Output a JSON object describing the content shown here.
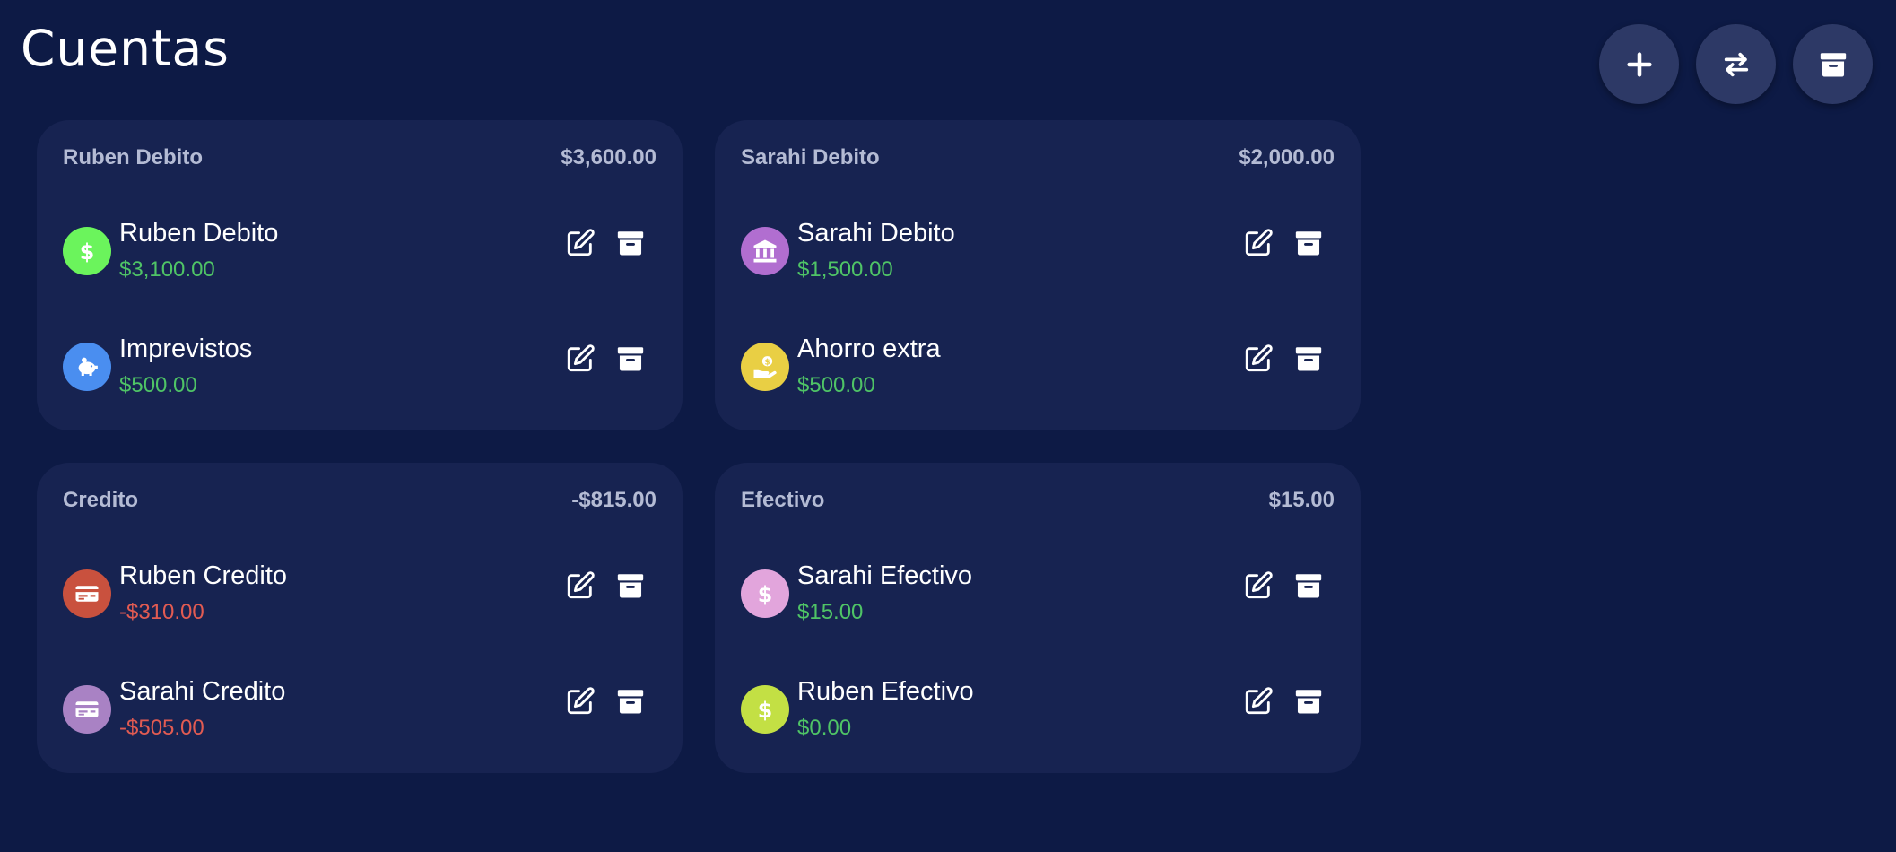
{
  "page": {
    "title": "Cuentas"
  },
  "toolbar": {
    "buttons": [
      {
        "name": "add-account-button",
        "icon": "plus-icon"
      },
      {
        "name": "transfer-button",
        "icon": "transfer-arrows-icon"
      },
      {
        "name": "archived-button",
        "icon": "archive-icon"
      }
    ]
  },
  "colors": {
    "background": "#0d1a45",
    "card": "#172351",
    "fab": "#2d3966",
    "positive": "#4fc466",
    "negative": "#e25b52",
    "header_text": "#b4bbd4"
  },
  "groups": [
    {
      "name": "Ruben Debito",
      "total": "$3,600.00",
      "accounts": [
        {
          "name": "Ruben Debito",
          "balance": "$3,100.00",
          "sign": "pos",
          "icon": "dollar-icon",
          "color": "#6bf45c"
        },
        {
          "name": "Imprevistos",
          "balance": "$500.00",
          "sign": "pos",
          "icon": "piggy-bank-icon",
          "color": "#4a8ef0"
        }
      ]
    },
    {
      "name": "Sarahi Debito",
      "total": "$2,000.00",
      "accounts": [
        {
          "name": "Sarahi Debito",
          "balance": "$1,500.00",
          "sign": "pos",
          "icon": "bank-icon",
          "color": "#b16ed0"
        },
        {
          "name": "Ahorro extra",
          "balance": "$500.00",
          "sign": "pos",
          "icon": "hand-coin-icon",
          "color": "#e9cf44"
        }
      ]
    },
    {
      "name": "Credito",
      "total": "-$815.00",
      "accounts": [
        {
          "name": "Ruben Credito",
          "balance": "-$310.00",
          "sign": "neg",
          "icon": "credit-card-icon",
          "color": "#c9513e"
        },
        {
          "name": "Sarahi Credito",
          "balance": "-$505.00",
          "sign": "neg",
          "icon": "credit-card-icon",
          "color": "#a982c4"
        }
      ]
    },
    {
      "name": "Efectivo",
      "total": "$15.00",
      "accounts": [
        {
          "name": "Sarahi Efectivo",
          "balance": "$15.00",
          "sign": "pos",
          "icon": "dollar-icon",
          "color": "#e2a5dc"
        },
        {
          "name": "Ruben Efectivo",
          "balance": "$0.00",
          "sign": "pos",
          "icon": "dollar-icon",
          "color": "#c3e044"
        }
      ]
    }
  ]
}
